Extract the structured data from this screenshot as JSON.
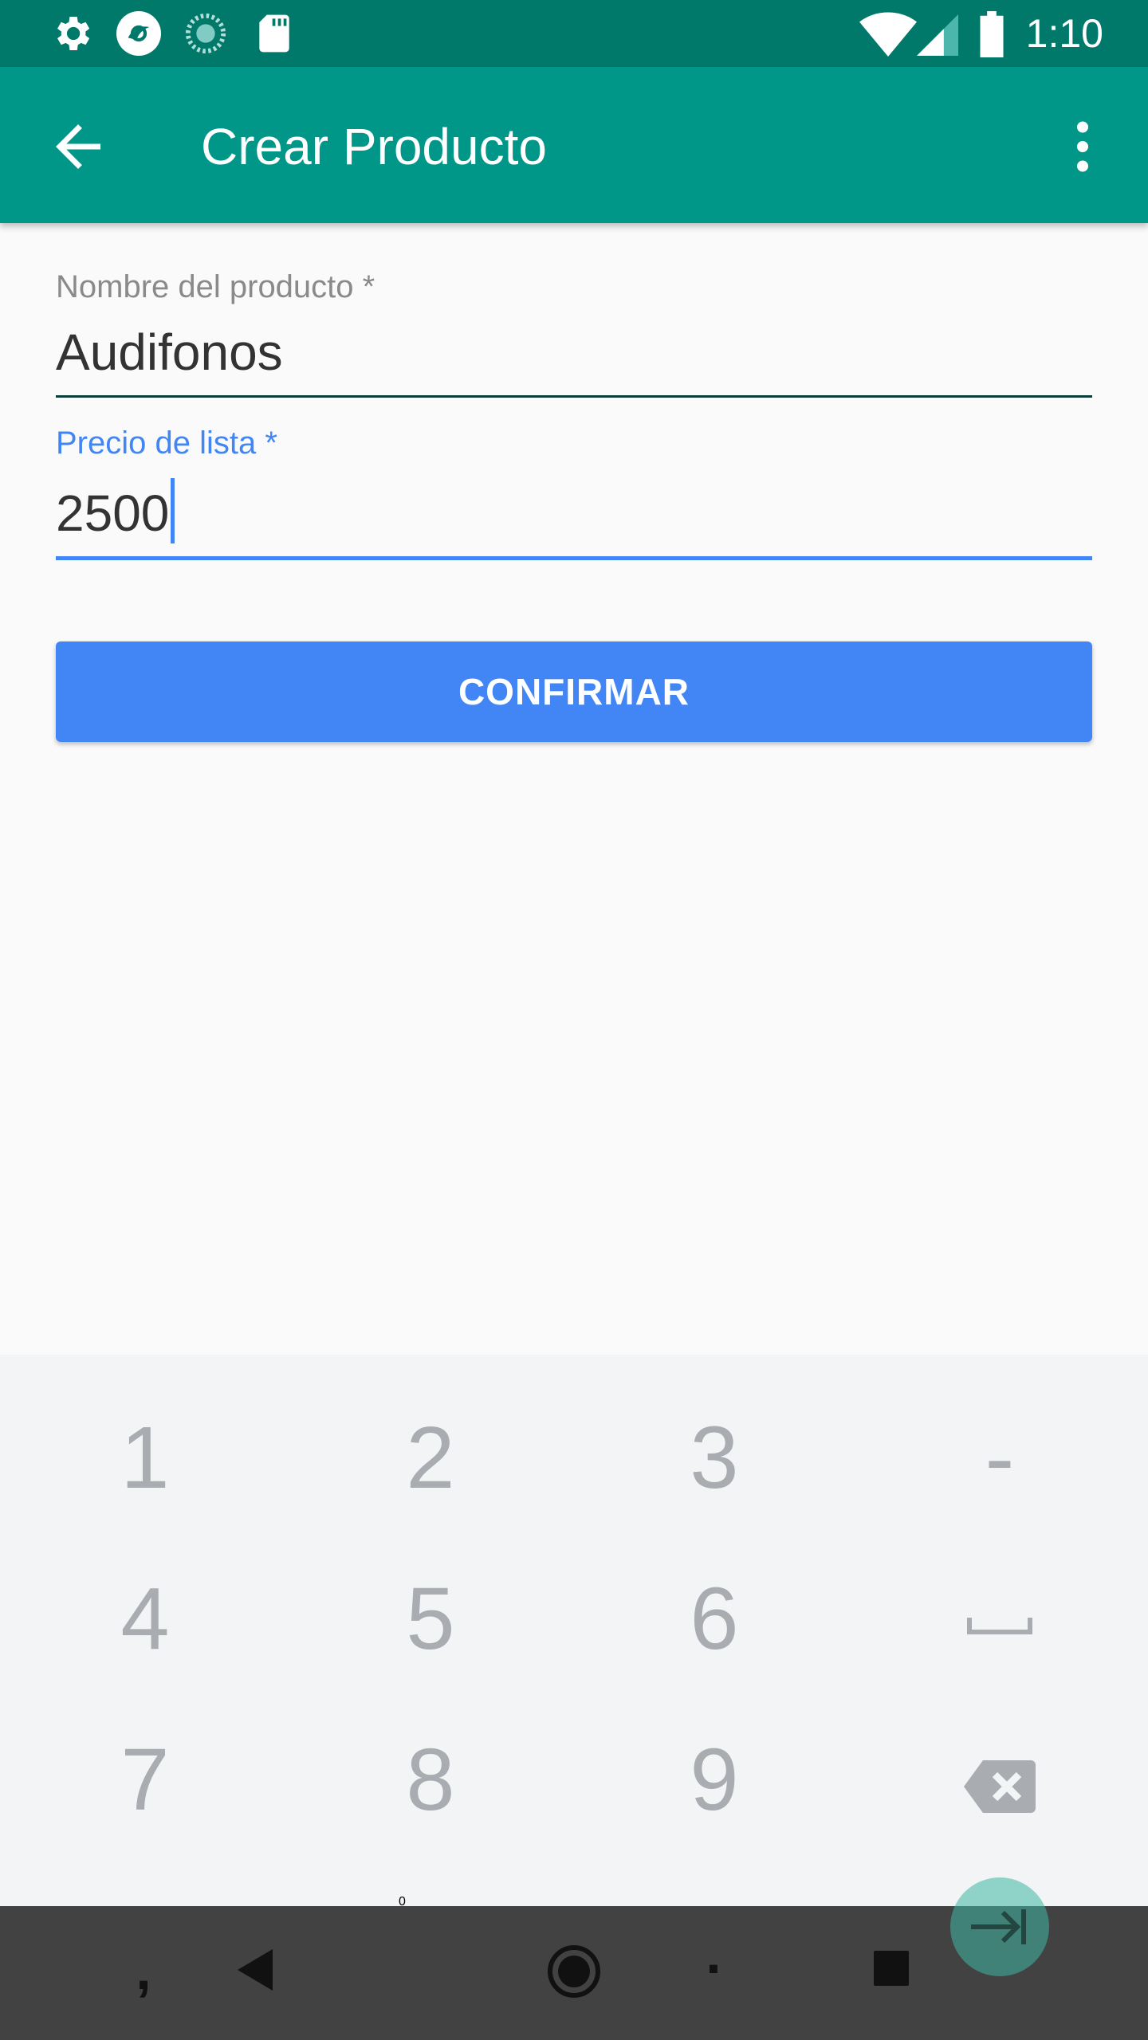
{
  "status_bar": {
    "time": "1:10",
    "icons": [
      "gear-icon",
      "app-logo-icon",
      "sync-icon",
      "sd-card-icon",
      "wifi-icon",
      "signal-icon",
      "battery-icon"
    ]
  },
  "app_bar": {
    "title": "Crear Producto",
    "color": "#009688"
  },
  "form": {
    "name_field": {
      "label": "Nombre del producto *",
      "value": "Audifonos"
    },
    "price_field": {
      "label": "Precio de lista *",
      "value": "2500"
    },
    "confirm_label": "CONFIRMAR"
  },
  "keyboard": {
    "row1": [
      "1",
      "2",
      "3",
      "-"
    ],
    "row2": [
      "4",
      "5",
      "6"
    ],
    "row3": [
      "7",
      "8",
      "9"
    ],
    "row4": [
      ",",
      "0",
      "."
    ],
    "icons": [
      "space-icon",
      "backspace-icon",
      "next-field-icon"
    ]
  },
  "colors": {
    "accent": "#4285f4",
    "primary": "#009688",
    "primary_dark": "#00796b"
  }
}
